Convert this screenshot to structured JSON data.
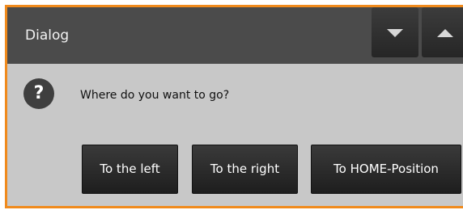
{
  "dialog": {
    "title": "Dialog",
    "titlebar_buttons": [
      {
        "name": "collapse-button",
        "icon": "triangle-down-icon"
      },
      {
        "name": "expand-button",
        "icon": "triangle-up-icon"
      }
    ],
    "question_icon": "question-icon",
    "question_glyph": "?",
    "message": "Where do you want to go?",
    "buttons": {
      "left_label": "To the left",
      "right_label": "To the right",
      "home_label": "To HOME-Position"
    }
  },
  "colors": {
    "border": "#f08a1c",
    "titlebar": "#4b4b4b",
    "body": "#c8c8c8",
    "button": "#262626"
  }
}
